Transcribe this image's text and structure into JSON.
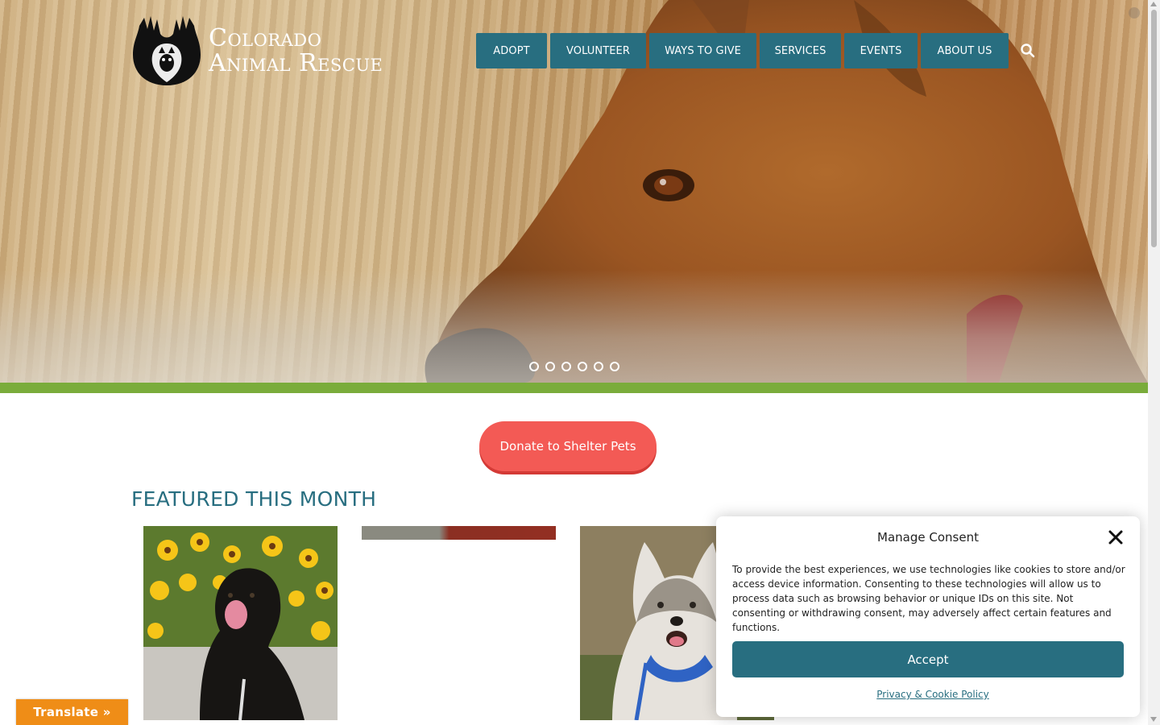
{
  "site": {
    "logo_line1": "Colorado",
    "logo_line2": "Animal Rescue"
  },
  "nav": {
    "items": [
      {
        "label": "ADOPT"
      },
      {
        "label": "VOLUNTEER"
      },
      {
        "label": "WAYS TO GIVE"
      },
      {
        "label": "SERVICES"
      },
      {
        "label": "EVENTS"
      },
      {
        "label": "ABOUT US"
      }
    ],
    "search_icon": "search-icon"
  },
  "hero": {
    "slide_count": 6,
    "active_slide": 0
  },
  "donate": {
    "label": "Donate to Shelter Pets"
  },
  "featured": {
    "title": "FEATURED THIS MONTH"
  },
  "translate": {
    "label": "Translate »"
  },
  "consent": {
    "title": "Manage Consent",
    "body": "To provide the best experiences, we use technologies like cookies to store and/or access device information. Consenting to these technologies will allow us to process data such as browsing behavior or unique IDs on this site. Not consenting or withdrawing consent, may adversely affect certain features and functions.",
    "accept_label": "Accept",
    "policy_link": "Privacy & Cookie Policy"
  },
  "colors": {
    "nav_bg": "#286e80",
    "accent_green": "#7aac3b",
    "donate_red": "#f35a55",
    "translate_orange": "#ef8d17"
  }
}
